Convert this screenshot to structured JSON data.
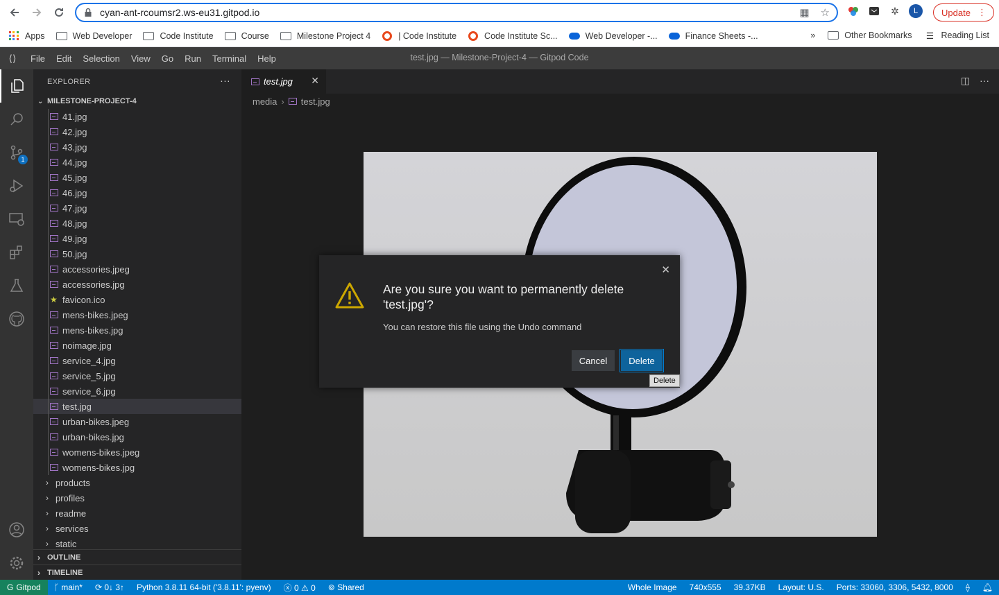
{
  "browser": {
    "url": "cyan-ant-rcoumsr2.ws-eu31.gitpod.io",
    "avatar_letter": "L",
    "update_label": "Update",
    "bookmarks": [
      {
        "label": "Apps",
        "icon": "apps-grid-icon"
      },
      {
        "label": "Web Developer",
        "icon": "folder-icon"
      },
      {
        "label": "Code Institute",
        "icon": "folder-icon"
      },
      {
        "label": "Course",
        "icon": "folder-icon"
      },
      {
        "label": "Milestone Project 4",
        "icon": "folder-icon"
      },
      {
        "label": "| Code Institute",
        "icon": "ring-icon"
      },
      {
        "label": "Code Institute Sc...",
        "icon": "ring-icon"
      },
      {
        "label": "Web Developer -...",
        "icon": "cloud-icon"
      },
      {
        "label": "Finance Sheets -...",
        "icon": "cloud-icon"
      }
    ],
    "overflow": "»",
    "other_bookmarks": "Other Bookmarks",
    "reading_list": "Reading List"
  },
  "vscode": {
    "menu": [
      "File",
      "Edit",
      "Selection",
      "View",
      "Go",
      "Run",
      "Terminal",
      "Help"
    ],
    "window_title": "test.jpg — Milestone-Project-4 — Gitpod Code",
    "scm_badge": "1",
    "explorer": {
      "header": "EXPLORER",
      "more": "···",
      "project": "MILESTONE-PROJECT-4",
      "files": [
        "41.jpg",
        "42.jpg",
        "43.jpg",
        "44.jpg",
        "45.jpg",
        "46.jpg",
        "47.jpg",
        "48.jpg",
        "49.jpg",
        "50.jpg",
        "accessories.jpeg",
        "accessories.jpg",
        "favicon.ico",
        "mens-bikes.jpeg",
        "mens-bikes.jpg",
        "noimage.jpg",
        "service_4.jpg",
        "service_5.jpg",
        "service_6.jpg",
        "test.jpg",
        "urban-bikes.jpeg",
        "urban-bikes.jpg",
        "womens-bikes.jpeg",
        "womens-bikes.jpg"
      ],
      "selected_file": "test.jpg",
      "folders": [
        "products",
        "profiles",
        "readme",
        "services",
        "static"
      ],
      "outline": "OUTLINE",
      "timeline": "TIMELINE"
    },
    "editor": {
      "tab_label": "test.jpg",
      "breadcrumb": [
        "media",
        "test.jpg"
      ]
    },
    "dialog": {
      "message": "Are you sure you want to permanently delete 'test.jpg'?",
      "detail": "You can restore this file using the Undo command",
      "cancel": "Cancel",
      "delete": "Delete",
      "tooltip": "Delete"
    },
    "status": {
      "gitpod": "Gitpod",
      "branch": "main*",
      "sync": "0↓ 3↑",
      "python": "Python 3.8.11 64-bit ('3.8.11': pyenv)",
      "problems": "0",
      "warnings": "0",
      "shared": "Shared",
      "whole_image": "Whole Image",
      "dimensions": "740x555",
      "size": "39.37KB",
      "layout": "Layout: U.S.",
      "ports": "Ports: 33060, 3306, 5432, 8000"
    }
  },
  "colors": {
    "accent": "#007acc",
    "gitpod_green": "#16825d",
    "delete_button": "#0e639c",
    "warning": "#cca700",
    "update_red": "#d93025"
  }
}
